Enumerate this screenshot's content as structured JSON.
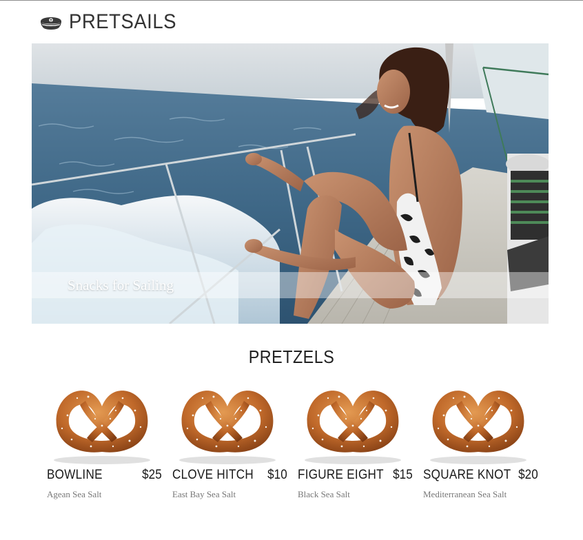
{
  "header": {
    "brand_name": "PRETSAILS",
    "brand_icon": "captain-hat-icon"
  },
  "hero": {
    "caption": "Snacks for Sailing"
  },
  "section": {
    "title": "PRETZELS"
  },
  "products": [
    {
      "name": "BOWLINE",
      "price": "$25",
      "description": "Agean Sea Salt",
      "image_icon": "pretzel-icon"
    },
    {
      "name": "CLOVE HITCH",
      "price": "$10",
      "description": "East Bay Sea Salt",
      "image_icon": "pretzel-icon"
    },
    {
      "name": "FIGURE EIGHT",
      "price": "$15",
      "description": "Black Sea Salt",
      "image_icon": "pretzel-icon"
    },
    {
      "name": "SQUARE KNOT",
      "price": "$20",
      "description": "Mediterranean Sea Salt",
      "image_icon": "pretzel-icon"
    }
  ],
  "colors": {
    "text": "#1a1a1a",
    "muted": "#777777",
    "pretzel": "#c0692a"
  }
}
